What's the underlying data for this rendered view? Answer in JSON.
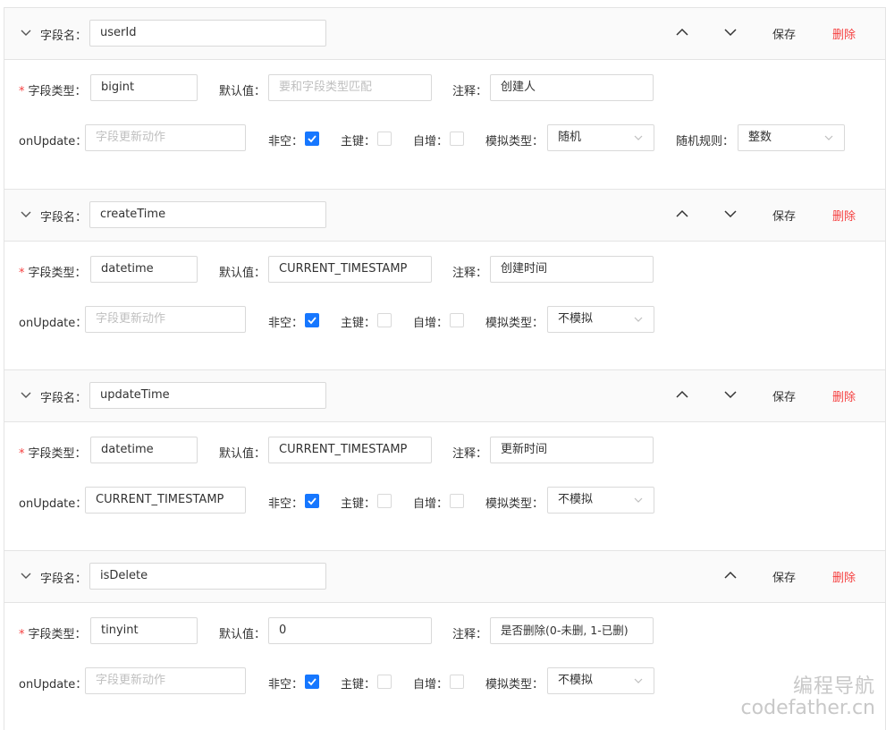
{
  "labels": {
    "field_name": "字段名",
    "field_type": "字段类型",
    "default": "默认值",
    "comment": "注释",
    "on_update": "onUpdate",
    "not_null": "非空",
    "primary_key": "主键",
    "auto_inc": "自增",
    "mock_type": "模拟类型",
    "random_rule": "随机规则",
    "save": "保存",
    "delete": "删除",
    "default_placeholder": "要和字段类型匹配",
    "onupdate_placeholder": "字段更新动作"
  },
  "fields": [
    {
      "name": "userId",
      "type": "bigint",
      "default": "",
      "comment": "创建人",
      "on_update": "",
      "not_null": true,
      "primary_key": false,
      "auto_inc": false,
      "mock_type": "随机",
      "random_rule": "整数"
    },
    {
      "name": "createTime",
      "type": "datetime",
      "default": "CURRENT_TIMESTAMP",
      "comment": "创建时间",
      "on_update": "",
      "not_null": true,
      "primary_key": false,
      "auto_inc": false,
      "mock_type": "不模拟"
    },
    {
      "name": "updateTime",
      "type": "datetime",
      "default": "CURRENT_TIMESTAMP",
      "comment": "更新时间",
      "on_update": "CURRENT_TIMESTAMP",
      "not_null": true,
      "primary_key": false,
      "auto_inc": false,
      "mock_type": "不模拟"
    },
    {
      "name": "isDelete",
      "type": "tinyint",
      "default": "0",
      "comment": "是否删除(0-未删, 1-已删)",
      "on_update": "",
      "not_null": true,
      "primary_key": false,
      "auto_inc": false,
      "mock_type": "不模拟"
    }
  ],
  "watermark": {
    "line1": "编程导航",
    "line2": "codefather.cn"
  }
}
